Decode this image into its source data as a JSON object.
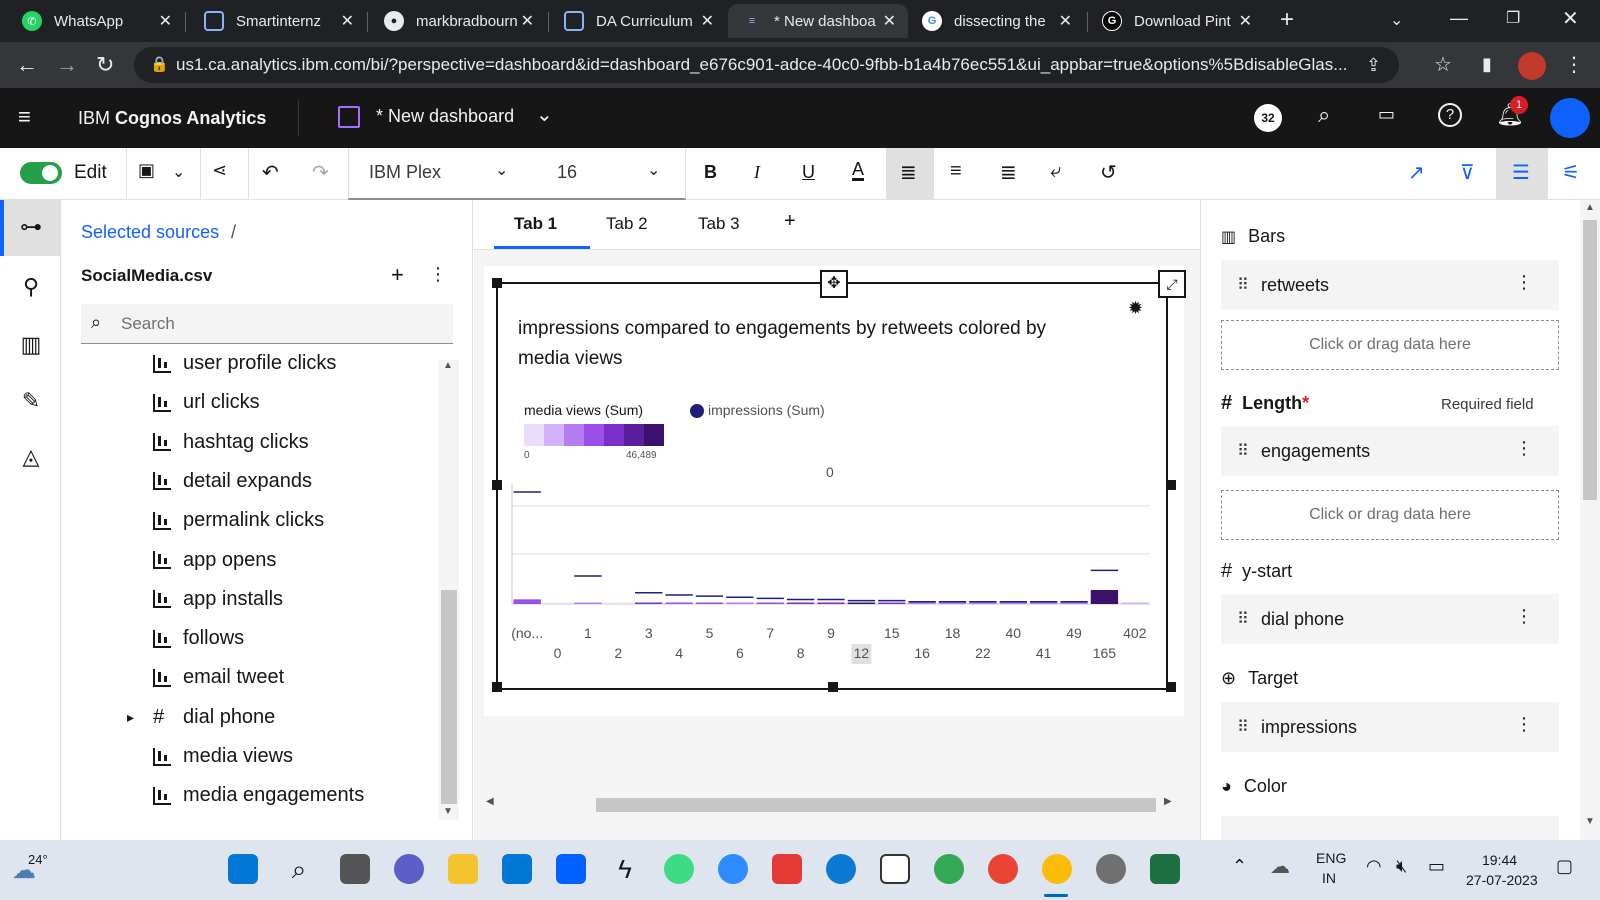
{
  "browser": {
    "tabs": [
      {
        "title": "WhatsApp",
        "icon": "whatsapp-icon",
        "active": false
      },
      {
        "title": "Smartinternz",
        "icon": "globe-icon",
        "active": false
      },
      {
        "title": "markbradbourn",
        "icon": "github-icon",
        "active": false
      },
      {
        "title": "DA Curriculum",
        "icon": "globe-icon",
        "active": false
      },
      {
        "title": "* New dashboa",
        "icon": "cognos-icon",
        "active": true
      },
      {
        "title": "dissecting the",
        "icon": "google-icon",
        "active": false
      },
      {
        "title": "Download Pint",
        "icon": "g-icon",
        "active": false
      }
    ],
    "url": "us1.ca.analytics.ibm.com/bi/?perspective=dashboard&id=dashboard_e676c901-adce-40c0-9fbb-b1a4b76ec551&ui_appbar=true&options%5BdisableGlas..."
  },
  "app": {
    "product": "IBM Cognos Analytics",
    "product_bold": "Cognos Analytics",
    "product_prefix": "IBM",
    "dashboard_title": "* New dashboard",
    "badge_count": "32",
    "notification_count": "1"
  },
  "toolbar": {
    "edit_label": "Edit",
    "font_family": "IBM Plex",
    "font_size": "16"
  },
  "sources": {
    "breadcrumb": "Selected sources",
    "breadcrumb_sep": "/",
    "file": "SocialMedia.csv",
    "search_placeholder": "Search",
    "items": [
      {
        "label": "user profile clicks",
        "type": "measure"
      },
      {
        "label": "url clicks",
        "type": "measure"
      },
      {
        "label": "hashtag clicks",
        "type": "measure"
      },
      {
        "label": "detail expands",
        "type": "measure"
      },
      {
        "label": "permalink clicks",
        "type": "measure"
      },
      {
        "label": "app opens",
        "type": "measure"
      },
      {
        "label": "app installs",
        "type": "measure"
      },
      {
        "label": "follows",
        "type": "measure"
      },
      {
        "label": "email tweet",
        "type": "measure"
      },
      {
        "label": "dial phone",
        "type": "identifier"
      },
      {
        "label": "media views",
        "type": "measure"
      },
      {
        "label": "media engagements",
        "type": "measure"
      }
    ]
  },
  "canvas": {
    "tabs": [
      "Tab 1",
      "Tab 2",
      "Tab 3"
    ],
    "add_tab": "+"
  },
  "chart_data": {
    "type": "bar",
    "title": "impressions compared to engagements by retweets colored by media views",
    "color_legend": {
      "title": "media views (Sum)",
      "min": "0",
      "max": "46,489"
    },
    "target_legend": "impressions (Sum)",
    "axis_top_label": "0",
    "categories_row1": [
      "(no...",
      "1",
      "3",
      "5",
      "7",
      "9",
      "15",
      "18",
      "40",
      "49",
      "402"
    ],
    "categories_row2": [
      "0",
      "2",
      "4",
      "6",
      "8",
      "12",
      "16",
      "22",
      "41",
      "165"
    ],
    "categories": [
      "(no...",
      "0",
      "1",
      "2",
      "3",
      "4",
      "5",
      "6",
      "7",
      "8",
      "9",
      "12",
      "15",
      "16",
      "18",
      "22",
      "40",
      "41",
      "49",
      "165",
      "402"
    ],
    "engagements": [
      4,
      1,
      0.5,
      0.3,
      0.4,
      0.3,
      0.3,
      0.2,
      0.2,
      0.2,
      0.2,
      0.3,
      0.2,
      0.1,
      0.1,
      0.1,
      0.1,
      0.1,
      0.1,
      12,
      0.1
    ],
    "impressions_target": [
      100,
      0,
      25,
      0,
      10,
      8,
      7,
      6,
      5,
      4,
      4,
      3,
      3,
      2,
      2,
      2,
      2,
      2,
      2,
      30,
      0
    ],
    "media_views_level": [
      0.5,
      0.05,
      0.4,
      0.1,
      0.6,
      0.5,
      0.5,
      0.4,
      0.5,
      0.6,
      0.7,
      0.9,
      0.6,
      0.3,
      0.3,
      0.3,
      0.3,
      0.3,
      0.3,
      1.0,
      0.2
    ],
    "highlighted_category": "12"
  },
  "fields": {
    "bars_title": "Bars",
    "bars_value": "retweets",
    "dropzone_text": "Click or drag data here",
    "length_title": "Length",
    "length_required_mark": "*",
    "required_text": "Required field",
    "length_value": "engagements",
    "ystart_title": "y-start",
    "ystart_value": "dial phone",
    "target_title": "Target",
    "target_value": "impressions",
    "color_title": "Color"
  },
  "taskbar": {
    "weather": "24°",
    "lang1": "ENG",
    "lang2": "IN",
    "time": "19:44",
    "date": "27-07-2023"
  },
  "colors": {
    "accent": "#0f62fe",
    "toggle_on": "#24a148",
    "legend_swatches": [
      "#ecdcfb",
      "#d4b2f7",
      "#b67df0",
      "#9a4fe6",
      "#7a2fc9",
      "#5a1d9e",
      "#3b116b"
    ],
    "target_line": "#1f1f7a"
  }
}
